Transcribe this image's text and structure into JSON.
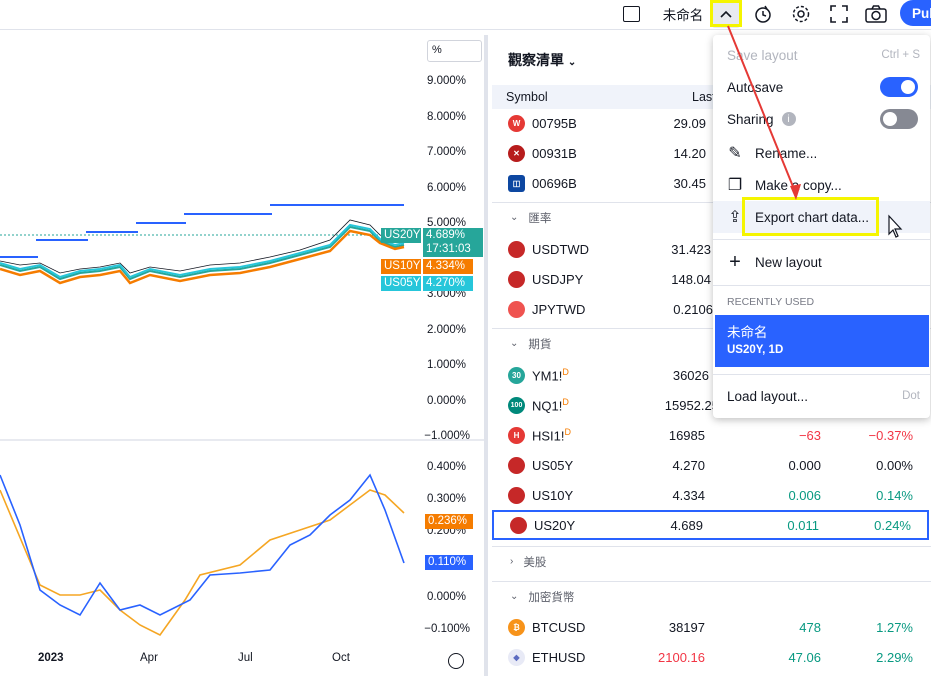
{
  "topbar": {
    "layout_name": "未命名",
    "publish_label": "Pul"
  },
  "chart": {
    "price_axis_unit": "%",
    "price_axis_labels": [
      "9.000%",
      "8.000%",
      "7.000%",
      "6.000%",
      "5.000%",
      "4.000%",
      "3.000%",
      "2.000%",
      "1.000%",
      "0.000%",
      "−1.000%"
    ],
    "indicator_axis_labels": [
      "0.400%",
      "0.300%",
      "0.200%",
      "0.100%",
      "0.000%",
      "−0.100%"
    ],
    "time_labels": [
      "2023",
      "Apr",
      "Jul",
      "Oct"
    ],
    "tags": {
      "us20y_name": "US20Y",
      "us20y_value": "4.689%",
      "us20y_time": "17:31:03",
      "us10y_name": "US10Y",
      "us10y_value": "4.334%",
      "us05y_name": "US05Y",
      "us05y_value": "4.270%",
      "ind_orange": "0.236%",
      "ind_blue": "0.110%"
    },
    "colors": {
      "us20y": "#26a69a",
      "us10y": "#f57c00",
      "us05y": "#26c6da",
      "indicator_blue": "#2962ff"
    }
  },
  "watchlist": {
    "title": "觀察清單",
    "col_symbol": "Symbol",
    "col_last": "Last",
    "rows_top": [
      {
        "sym": "00795B",
        "last": "29.09",
        "icon_color": "#e53935",
        "icon_text": "W"
      },
      {
        "sym": "00931B",
        "last": "14.20",
        "icon_color": "#b71c1c",
        "icon_text": "✕"
      },
      {
        "sym": "00696B",
        "last": "30.45",
        "icon_color": "#0d47a1",
        "icon_text": "◫"
      }
    ],
    "sec_fx": "匯率",
    "rows_fx": [
      {
        "sym": "USDTWD",
        "last": "31.423"
      },
      {
        "sym": "USDJPY",
        "last": "148.04"
      },
      {
        "sym": "JPYTWD",
        "last": "0.2106"
      }
    ],
    "sec_futures": "期貨",
    "rows_fut": [
      {
        "sym": "YM1!",
        "sup": "D",
        "last": "36026",
        "icon_text": "30",
        "icon_color": "#26a69a"
      },
      {
        "sym": "NQ1!",
        "sup": "D",
        "last": "15952.25",
        "icon_text": "100",
        "icon_color": "#00897b"
      },
      {
        "sym": "HSI1!",
        "sup": "D",
        "last": "16985",
        "chg": "−63",
        "chgp": "−0.37%",
        "icon_text": "H",
        "icon_color": "#e53935"
      },
      {
        "sym": "US05Y",
        "last": "4.270",
        "chg": "0.000",
        "chgp": "0.00%"
      },
      {
        "sym": "US10Y",
        "last": "4.334",
        "chg": "0.006",
        "chgp": "0.14%"
      },
      {
        "sym": "US20Y",
        "last": "4.689",
        "chg": "0.011",
        "chgp": "0.24%"
      }
    ],
    "sec_us": "美股",
    "sec_crypto": "加密貨幣",
    "rows_crypto": [
      {
        "sym": "BTCUSD",
        "last": "38197",
        "chg": "478",
        "chgp": "1.27%"
      },
      {
        "sym": "ETHUSD",
        "last": "2100.16",
        "chg": "47.06",
        "chgp": "2.29%"
      }
    ]
  },
  "menu": {
    "save_layout": "Save layout",
    "save_shortcut": "Ctrl + S",
    "autosave": "Autosave",
    "sharing": "Sharing",
    "rename": "Rename...",
    "make_copy": "Make a copy...",
    "export": "Export chart data...",
    "new_layout": "New layout",
    "recently_used": "RECENTLY USED",
    "recent_name": "未命名",
    "recent_sub": "US20Y, 1D",
    "load_layout": "Load layout...",
    "load_shortcut": "Dot"
  }
}
